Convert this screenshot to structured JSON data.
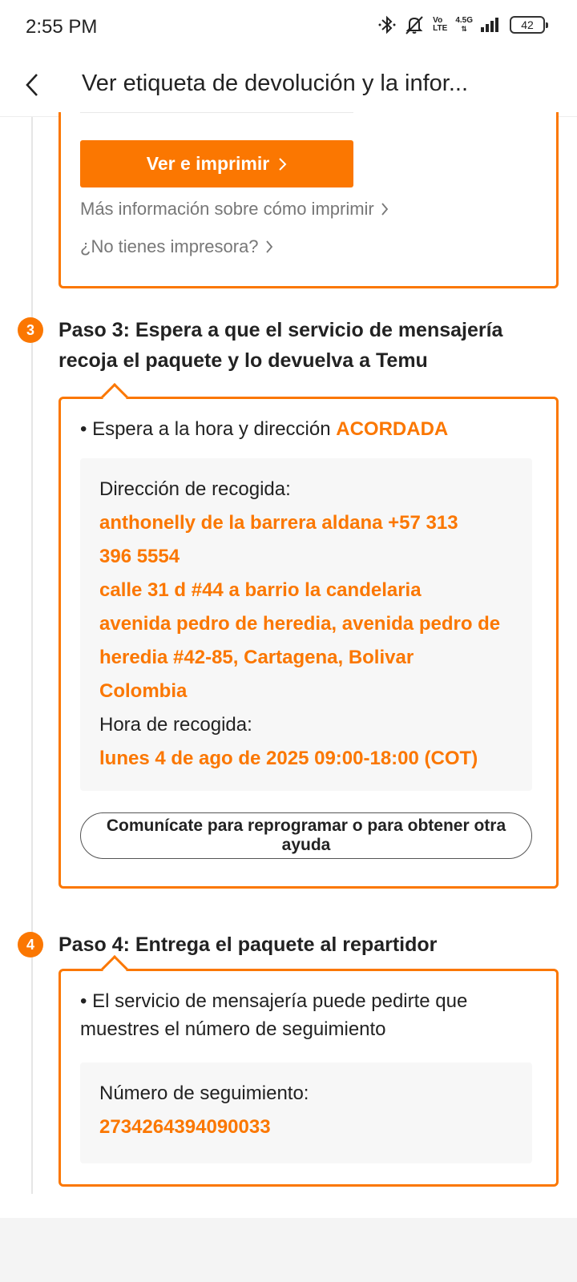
{
  "status_bar": {
    "time": "2:55 PM",
    "network_top": "4.5G",
    "volte_top": "Vo",
    "volte_bottom": "LTE",
    "battery": "42"
  },
  "header": {
    "title": "Ver etiqueta de devolución y la infor..."
  },
  "print_section": {
    "print_button": "Ver e imprimir",
    "more_info_link": "Más información sobre cómo imprimir",
    "no_printer_link": "¿No tienes impresora?"
  },
  "step3": {
    "number": "3",
    "title": "Paso 3: Espera a que el servicio de mensajería recoja el paquete y lo devuelva a Temu",
    "bullet_text": "• Espera a la hora y dirección ",
    "bullet_highlight": "ACORDADA",
    "address_label": "Dirección de recogida:",
    "address_lines": [
      "anthonelly de la barrera aldana +57 313",
      "396 5554",
      "calle 31 d #44 a barrio la candelaria",
      "avenida pedro de heredia, avenida pedro de",
      "heredia #42-85, Cartagena, Bolivar",
      "Colombia"
    ],
    "time_label": "Hora de recogida:",
    "time_value": "lunes 4 de ago de 2025 09:00-18:00 (COT)",
    "contact_button": "Comunícate para reprogramar o para obtener otra ayuda"
  },
  "step4": {
    "number": "4",
    "title": "Paso 4: Entrega el paquete al repartidor",
    "bullet_text": "• El servicio de mensajería puede pedirte que muestres el número de seguimiento",
    "tracking_label": "Número de seguimiento:",
    "tracking_value": "2734264394090033"
  },
  "colors": {
    "accent": "#fb7701"
  }
}
